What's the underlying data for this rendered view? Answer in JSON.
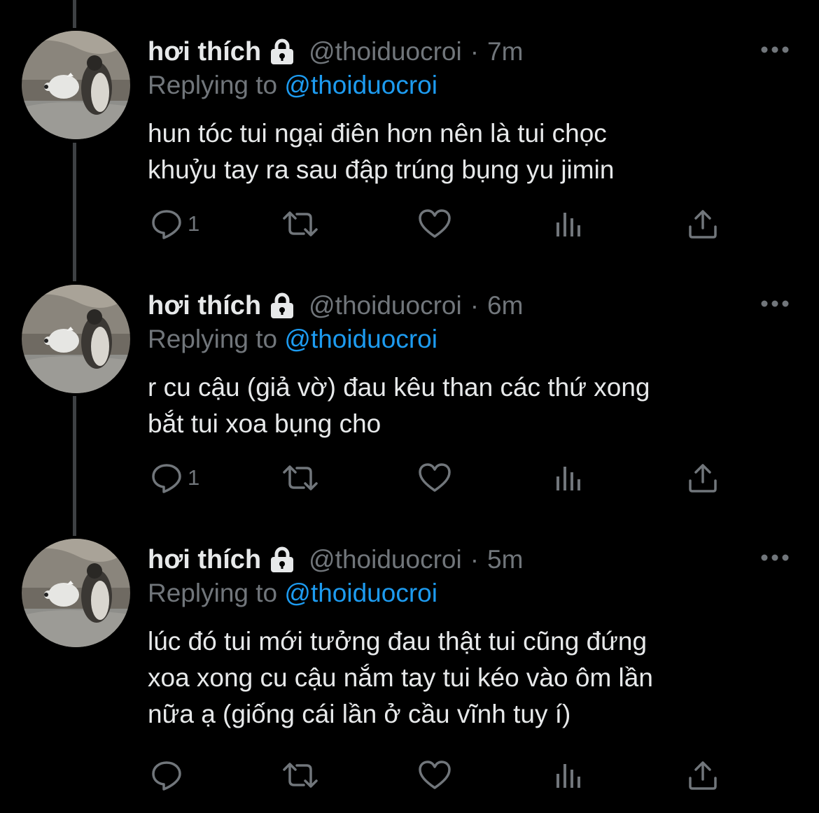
{
  "colors": {
    "background": "#000000",
    "text_primary": "#e7e9ea",
    "text_secondary": "#71767b",
    "mention": "#1d9bf0",
    "thread_line": "#3e4144"
  },
  "tweets": [
    {
      "display_name": "hơi thích",
      "handle": "@thoiduocroi",
      "dot": "·",
      "time": "7m",
      "replying_prefix": "Replying to",
      "replying_to": "@thoiduocroi",
      "text_lines": [
        "hun tóc tui ngại điên hơn nên là tui chọc",
        "khuỷu tay ra sau đập trúng bụng yu jimin"
      ],
      "actions": {
        "reply_count": "1",
        "retweet_count": "",
        "like_count": ""
      }
    },
    {
      "display_name": "hơi thích",
      "handle": "@thoiduocroi",
      "dot": "·",
      "time": "6m",
      "replying_prefix": "Replying to",
      "replying_to": "@thoiduocroi",
      "text_lines": [
        "r cu cậu (giả vờ) đau kêu than các thứ xong",
        "bắt tui xoa bụng cho"
      ],
      "actions": {
        "reply_count": "1",
        "retweet_count": "",
        "like_count": ""
      }
    },
    {
      "display_name": "hơi thích",
      "handle": "@thoiduocroi",
      "dot": "·",
      "time": "5m",
      "replying_prefix": "Replying to",
      "replying_to": "@thoiduocroi",
      "text_lines": [
        "lúc đó tui mới tưởng đau thật tui cũng đứng",
        "xoa xong cu cậu nắm tay tui kéo vào ôm lần",
        "nữa ạ (giống cái lần ở cầu vĩnh tuy í)"
      ],
      "actions": {
        "reply_count": "",
        "retweet_count": "",
        "like_count": ""
      }
    }
  ],
  "icons": {
    "avatar": "penguin-photo",
    "protected": "lock-icon",
    "more": "more-dots-icon",
    "reply": "reply-icon",
    "retweet": "retweet-icon",
    "like": "heart-icon",
    "analytics": "analytics-icon",
    "share": "share-icon"
  }
}
